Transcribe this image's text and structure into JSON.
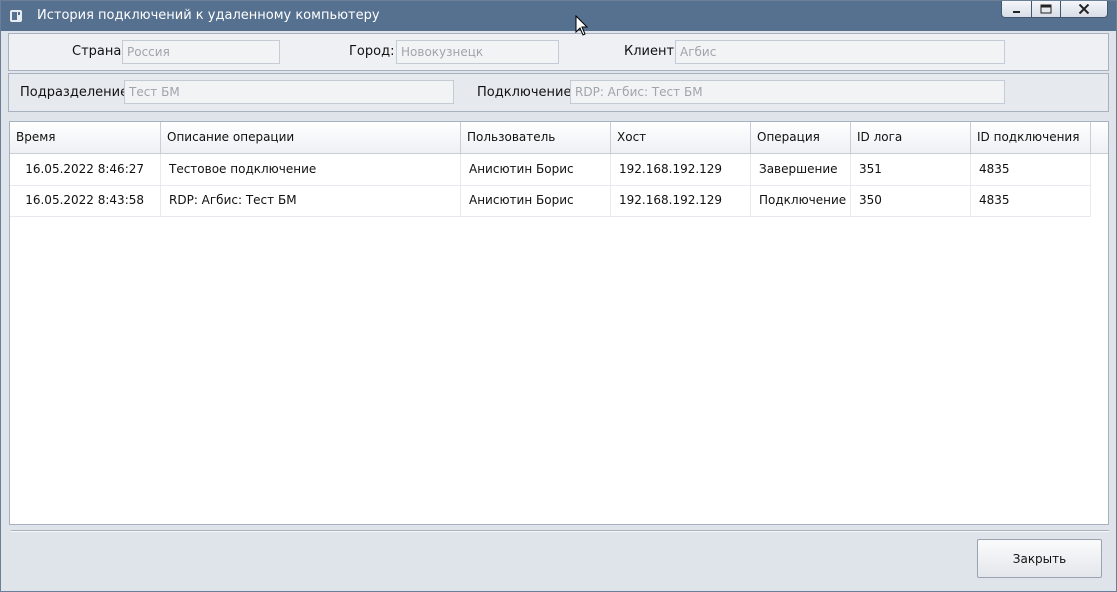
{
  "window": {
    "title": "История подключений к удаленному компьютеру",
    "controls": {
      "minimize": "minimize-icon",
      "maximize": "maximize-icon",
      "close": "close-icon"
    }
  },
  "filters": {
    "country": {
      "label": "Страна:",
      "value": "Россия"
    },
    "city": {
      "label": "Город:",
      "value": "Новокузнецк"
    },
    "client": {
      "label": "Клиент:",
      "value": "Агбис"
    },
    "division": {
      "label": "Подразделение:",
      "value": "Тест БМ"
    },
    "connection": {
      "label": "Подключение:",
      "value": "RDP: Агбис: Тест БМ"
    }
  },
  "table": {
    "columns": [
      "Время",
      "Описание операции",
      "Пользователь",
      "Хост",
      "Операция",
      "ID лога",
      "ID подключения"
    ],
    "rows": [
      [
        "16.05.2022 8:46:27",
        "Тестовое подключение",
        "Анисютин Борис",
        "192.168.192.129",
        "Завершение",
        "351",
        "4835"
      ],
      [
        "16.05.2022 8:43:58",
        "RDP: Агбис: Тест БМ",
        "Анисютин Борис",
        "192.168.192.129",
        "Подключение",
        "350",
        "4835"
      ]
    ]
  },
  "footer": {
    "close_label": "Закрыть"
  },
  "colors": {
    "titlebar": "#56708f",
    "panel": "#e6e9ee",
    "background": "#dfe3ea"
  }
}
